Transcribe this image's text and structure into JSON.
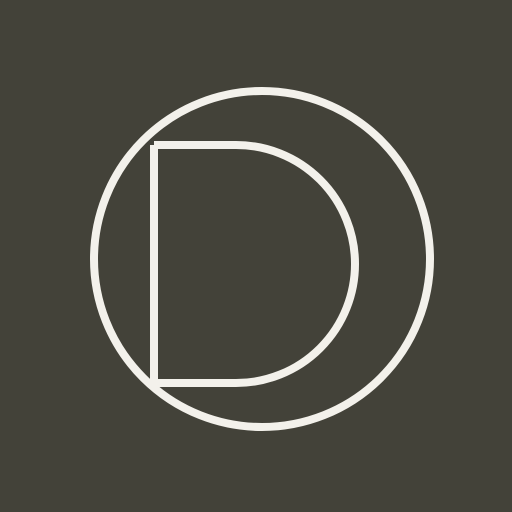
{
  "app_icon": {
    "logo_letter": "D",
    "icon_name": "circle-d-logo-icon",
    "colors": {
      "background": "#434239",
      "stroke": "#F3F1EB"
    }
  }
}
